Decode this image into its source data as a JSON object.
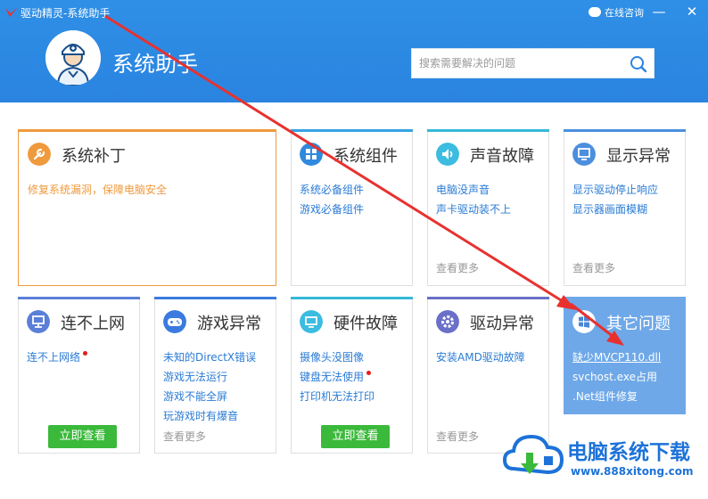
{
  "window": {
    "title": "驱动精灵-系统助手",
    "consult_label": "在线咨询",
    "minimize_glyph": "—",
    "close_glyph": "✕"
  },
  "header": {
    "app_title": "系统助手"
  },
  "search": {
    "placeholder": "搜索需要解决的问题"
  },
  "colors": {
    "header_blue": "#2a84e0",
    "link_blue": "#2a7bd4",
    "patch_orange": "#ef9a3c",
    "accent_green": "#3bb93b",
    "arrow_red": "#e8312f"
  },
  "cards": {
    "patch": {
      "title": "系统补丁",
      "icon": "wrench-icon",
      "desc": "修复系统漏洞，保障电脑安全"
    },
    "components": {
      "title": "系统组件",
      "icon": "puzzle-icon",
      "links": [
        "系统必备组件",
        "游戏必备组件"
      ]
    },
    "sound": {
      "title": "声音故障",
      "icon": "speaker-icon",
      "links": [
        "电脑没声音",
        "声卡驱动装不上"
      ],
      "more": "查看更多"
    },
    "display": {
      "title": "显示异常",
      "icon": "monitor-icon",
      "links": [
        "显示驱动停止响应",
        "显示器画面模糊"
      ],
      "more": "查看更多"
    },
    "network": {
      "title": "连不上网",
      "icon": "network-icon",
      "links": [
        "连不上网络"
      ],
      "button": "立即查看"
    },
    "game": {
      "title": "游戏异常",
      "icon": "gamepad-icon",
      "links": [
        "未知的DirectX错误",
        "游戏无法运行",
        "游戏不能全屏",
        "玩游戏时有爆音"
      ],
      "more": "查看更多"
    },
    "hardware": {
      "title": "硬件故障",
      "icon": "hardware-icon",
      "links": [
        "摄像头没图像",
        "键盘无法使用",
        "打印机无法打印"
      ],
      "button": "立即查看"
    },
    "driver": {
      "title": "驱动异常",
      "icon": "gear-icon",
      "links": [
        "安装AMD驱动故障"
      ],
      "more": "查看更多"
    },
    "other": {
      "title": "其它问题",
      "icon": "windows-icon",
      "links": [
        "缺少MVCP110.dll",
        "svchost.exe占用",
        ".Net组件修复"
      ]
    }
  },
  "watermark": {
    "text": "电脑系统下载",
    "url": "www.888xitong.com"
  }
}
